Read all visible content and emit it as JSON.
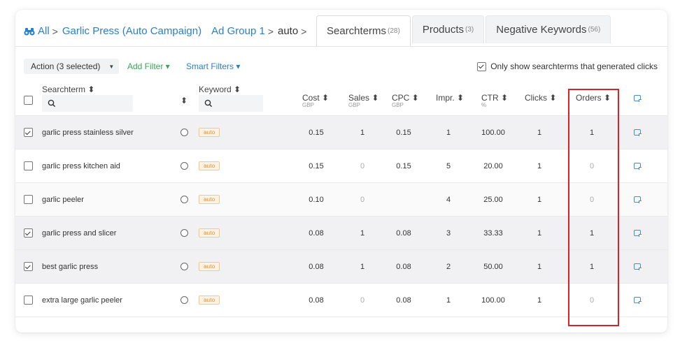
{
  "breadcrumb": {
    "items": [
      {
        "label": "All",
        "link": true
      },
      {
        "label": "Garlic Press (Auto Campaign)",
        "link": true
      },
      {
        "label": "Ad Group 1",
        "link": true
      },
      {
        "label": "auto",
        "link": false
      }
    ],
    "separator": ">"
  },
  "tabs": [
    {
      "label": "Searchterms",
      "count": "(28)",
      "active": true
    },
    {
      "label": "Products",
      "count": "(3)",
      "active": false
    },
    {
      "label": "Negative Keywords",
      "count": "(56)",
      "active": false
    }
  ],
  "toolbar": {
    "action_label": "Action (3 selected)",
    "add_filter_label": "Add Filter ▾",
    "smart_filters_label": "Smart Filters ▾",
    "only_show_label": "Only show searchterms that generated clicks",
    "only_show_checked": true
  },
  "columns": {
    "searchterm": "Searchterm ⬍",
    "keyword": "Keyword ⬍",
    "cost": "Cost ⬍",
    "cost_unit": "GBP",
    "sales": "Sales ⬍",
    "sales_unit": "GBP",
    "cpc": "CPC ⬍",
    "cpc_unit": "GBP",
    "impr": "Impr. ⬍",
    "ctr": "CTR ⬍",
    "ctr_unit": "%",
    "clicks": "Clicks ⬍",
    "orders": "Orders ⬍",
    "sort_glyph": "⬍"
  },
  "rows": [
    {
      "term": "garlic press stainless silver",
      "checked": true,
      "keyword": "auto",
      "cost": "0.15",
      "sales": "1",
      "cpc": "0.15",
      "impr": "1",
      "ctr": "100.00",
      "clicks": "1",
      "orders": "1"
    },
    {
      "term": "garlic press kitchen aid",
      "checked": false,
      "keyword": "auto",
      "cost": "0.15",
      "sales": "0",
      "cpc": "0.15",
      "impr": "5",
      "ctr": "20.00",
      "clicks": "1",
      "orders": "0"
    },
    {
      "term": "garlic peeler",
      "checked": false,
      "keyword": "auto",
      "cost": "0.10",
      "sales": "0",
      "cpc": "",
      "impr": "4",
      "ctr": "25.00",
      "clicks": "1",
      "orders": "0"
    },
    {
      "term": "garlic press and slicer",
      "checked": true,
      "keyword": "auto",
      "cost": "0.08",
      "sales": "1",
      "cpc": "0.08",
      "impr": "3",
      "ctr": "33.33",
      "clicks": "1",
      "orders": "1"
    },
    {
      "term": "best garlic press",
      "checked": true,
      "keyword": "auto",
      "cost": "0.08",
      "sales": "1",
      "cpc": "0.08",
      "impr": "2",
      "ctr": "50.00",
      "clicks": "1",
      "orders": "1"
    },
    {
      "term": "extra large garlic peeler",
      "checked": false,
      "keyword": "auto",
      "cost": "0.08",
      "sales": "0",
      "cpc": "0.08",
      "impr": "1",
      "ctr": "100.00",
      "clicks": "1",
      "orders": "0"
    }
  ],
  "colors": {
    "link": "#2a7fc8",
    "add_filter": "#3aa655",
    "highlight": "#d8232a",
    "auto_badge": "#e08c2e"
  },
  "icons": {
    "breadcrumb_root": "binoculars-icon",
    "search": "search-icon",
    "note": "note-icon",
    "match": "radio-icon"
  }
}
